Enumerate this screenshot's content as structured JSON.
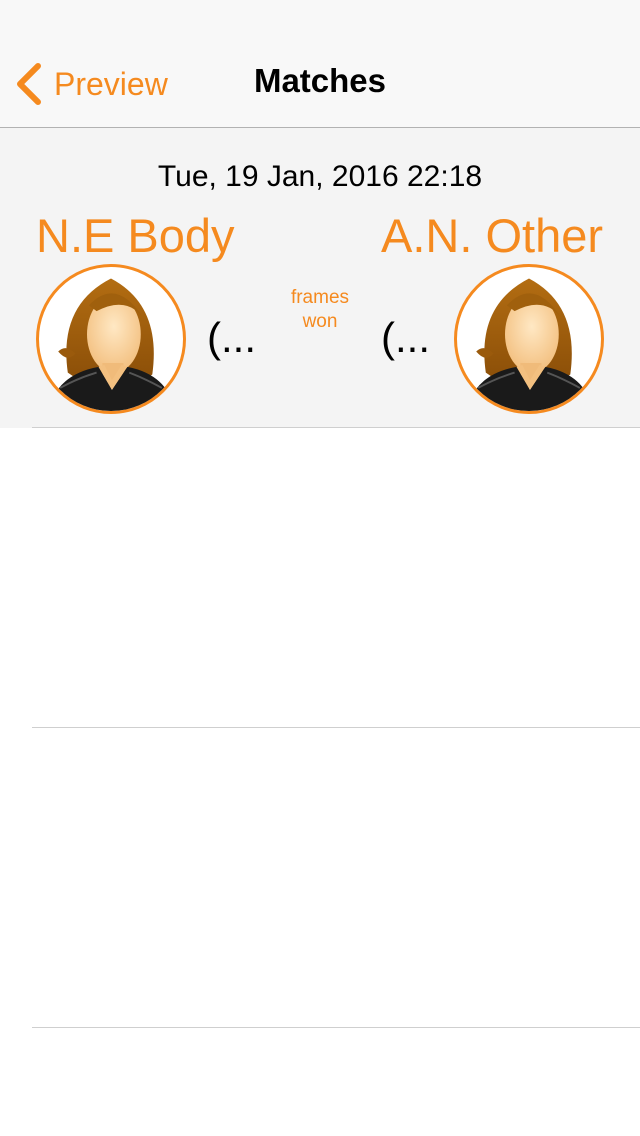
{
  "nav": {
    "back_label": "Preview",
    "title": "Matches"
  },
  "colors": {
    "accent": "#f58a1f",
    "row_background": "#f4f4f4"
  },
  "match": {
    "date": "Tue, 19 Jan, 2016 22:18",
    "frames_label_line1": "frames",
    "frames_label_line2": "won",
    "player1": {
      "name": "N.E Body",
      "frames_won": "(...",
      "avatar_icon": "female-avatar-icon"
    },
    "player2": {
      "name": "A.N. Other",
      "frames_won": "(...",
      "avatar_icon": "female-avatar-icon"
    }
  }
}
